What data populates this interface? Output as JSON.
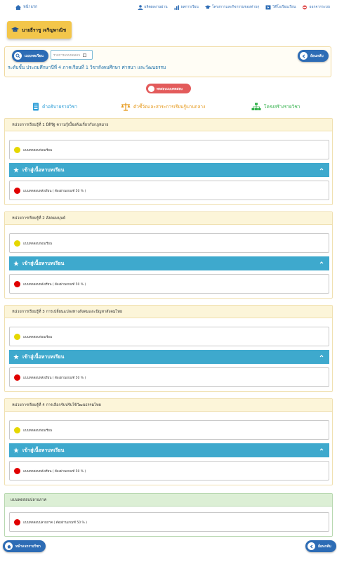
{
  "nav": {
    "home": "หน้าแรก",
    "items": [
      "ผลิตผลงานผ่าน",
      "ผลการเรียน",
      "โครงการและกิจกรรมของท่านๆ",
      "วิดีโอเรียนเรียน",
      "ออกจากระบบ"
    ]
  },
  "user": {
    "name": "นายธีราชู เจริญพาณิช"
  },
  "search": {
    "button": "แบบทดเรียน",
    "placeholder": "รายการแบบทดสอบ",
    "back": "ย้อนกลับ",
    "course_info": "ระดับชั้น ประถมศึกษาปีที่ 4   ภาคเรียนที่ 1   วิชาสังคมศึกษา ศาสนา และวัฒนธรรม"
  },
  "test_button": "ทดสอบแบบทดสอบ",
  "tabs": [
    "คำอธิบายรายวิชา",
    "ตัวชี้วัดและสาระการเรียนรู้แกนกลาง",
    "โครงสร้างรายวิชา"
  ],
  "units": [
    {
      "title": "หน่วยการเรียนรู้ที่ 1  มิติรัฐ ความรู้เบื้องต้นเกี่ยวกับกฎหมาย"
    },
    {
      "title": "หน่วยการเรียนรู้ที่ 2  สังคมมนุษย์"
    },
    {
      "title": "หน่วยการเรียนรู้ที่ 3  การเปลี่ยนแปลงทางสังคมและปัญหาสังคมไทย"
    },
    {
      "title": "หน่วยการเรียนรู้ที่ 4  การเลือกรับปรับใช้วัฒนธรรมไทย"
    }
  ],
  "labels": {
    "pretest": "แบบทดสอบก่อนเรียน",
    "enter_lesson": "เข้าสู่เนื้อหาบทเรียน",
    "posttest": "แบบทดสอบหลังเรียน   ( ต้องผ่านเกณฑ์ 50 % )"
  },
  "final": {
    "title": "แบบทดสอบปลายภาค",
    "item": "แบบทดสอบปลายภาค ( ต้องผ่านเกณฑ์ 50 % )"
  },
  "footer": {
    "home": "หน้าแรกรายวิชา",
    "back": "ย้อนกลับ"
  },
  "colors": {
    "primary": "#2d6cb5",
    "accent_bar": "#3ea9cd",
    "pretest_dot": "#e5d700",
    "posttest_dot": "#e00000",
    "badge": "#f3c64a",
    "test_button": "#e35b5b",
    "tab1": "#2f9fd8",
    "tab2": "#e69a1d",
    "tab3": "#31b04a"
  }
}
